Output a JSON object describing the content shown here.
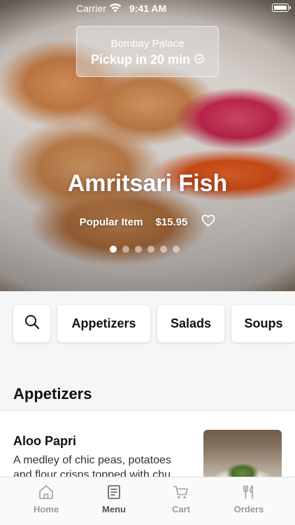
{
  "status_bar": {
    "carrier": "Carrier",
    "time": "9:41 AM"
  },
  "restaurant": {
    "name": "Bombay Palace",
    "pickup": "Pickup in 20 min"
  },
  "featured": {
    "title": "Amritsari Fish",
    "tag": "Popular Item",
    "price": "$15.95",
    "carousel": {
      "count": 6,
      "active_index": 0
    }
  },
  "categories": [
    "Appetizers",
    "Salads",
    "Soups"
  ],
  "section": {
    "title": "Appetizers"
  },
  "items": [
    {
      "name": "Aloo Papri",
      "description": "A medley of chic peas, potatoes and flour crisps topped with chu…"
    }
  ],
  "tabs": [
    {
      "label": "Home",
      "icon": "home-icon",
      "active": false
    },
    {
      "label": "Menu",
      "icon": "menu-book-icon",
      "active": true
    },
    {
      "label": "Cart",
      "icon": "cart-icon",
      "active": false
    },
    {
      "label": "Orders",
      "icon": "utensils-icon",
      "active": false
    }
  ]
}
